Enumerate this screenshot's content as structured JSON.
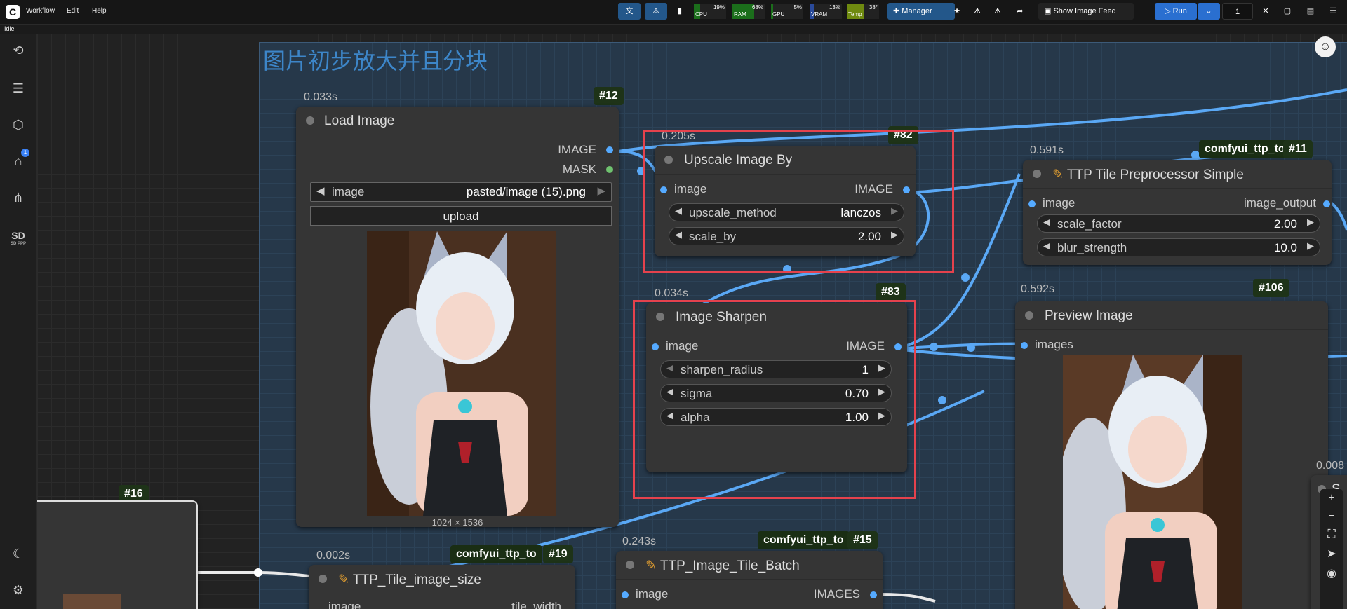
{
  "menu": {
    "workflow": "Workflow",
    "edit": "Edit",
    "help": "Help"
  },
  "status": "Idle",
  "monitors": [
    {
      "label": "CPU",
      "value": "19%",
      "fill": 0.19
    },
    {
      "label": "RAM",
      "value": "68%",
      "fill": 0.68
    },
    {
      "label": "GPU",
      "value": "5%",
      "fill": 0.05
    },
    {
      "label": "VRAM",
      "value": "13%",
      "fill": 0.13
    },
    {
      "label": "Temp",
      "value": "38°",
      "fill": 0.38
    }
  ],
  "toolbar": {
    "manager": "Manager",
    "show_image_feed": "Show Image Feed",
    "run": "Run",
    "batch_count": "1"
  },
  "sidebar": {
    "queue_badge": "1",
    "sdppp": "SD PPP"
  },
  "group_title": "图片初步放大并且分块",
  "nodes": {
    "load_image": {
      "time": "0.033s",
      "id": "#12",
      "title": "Load Image",
      "out_image": "IMAGE",
      "out_mask": "MASK",
      "widget_name": "image",
      "widget_value": "pasted/image (15).png",
      "upload": "upload",
      "dims": "1024 × 1536"
    },
    "upscale": {
      "time": "0.205s",
      "id": "#82",
      "title": "Upscale Image By",
      "in_image": "image",
      "out_image": "IMAGE",
      "w1_name": "upscale_method",
      "w1_value": "lanczos",
      "w2_name": "scale_by",
      "w2_value": "2.00"
    },
    "sharpen": {
      "time": "0.034s",
      "id": "#83",
      "title": "Image Sharpen",
      "in_image": "image",
      "out_image": "IMAGE",
      "w1_name": "sharpen_radius",
      "w1_value": "1",
      "w2_name": "sigma",
      "w2_value": "0.70",
      "w3_name": "alpha",
      "w3_value": "1.00"
    },
    "ttp_tile": {
      "time": "0.591s",
      "id": "#11",
      "pack": "comfyui_ttp_to",
      "title": "TTP Tile Preprocessor Simple",
      "in_image": "image",
      "out_image": "image_output",
      "w1_name": "scale_factor",
      "w1_value": "2.00",
      "w2_name": "blur_strength",
      "w2_value": "10.0"
    },
    "preview": {
      "time": "0.592s",
      "id": "#106",
      "title": "Preview Image",
      "in_images": "images"
    },
    "tile_size": {
      "time": "0.002s",
      "id": "#19",
      "pack": "comfyui_ttp_to",
      "title": "TTP_Tile_image_size",
      "in_image": "image",
      "out_tile": "tile_width"
    },
    "tile_batch": {
      "time": "0.243s",
      "id": "#15",
      "pack": "comfyui_ttp_to",
      "title": "TTP_Image_Tile_Batch",
      "in_image": "image",
      "out_images": "IMAGES"
    },
    "left_node": {
      "id": "#16"
    },
    "right_edge": {
      "time": "0.008",
      "title_letter": "S"
    }
  }
}
